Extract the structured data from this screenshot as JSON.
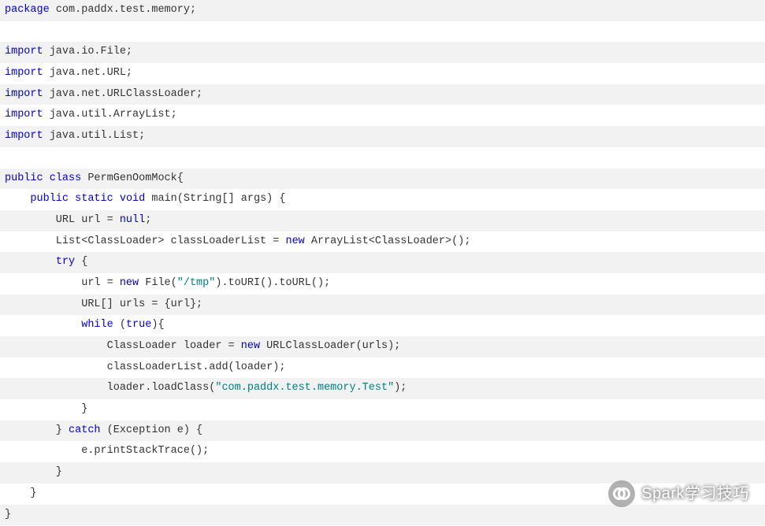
{
  "code": {
    "lines": [
      [
        {
          "c": "kw",
          "t": "package"
        },
        {
          "c": "txt",
          "t": " com.paddx.test.memory;"
        }
      ],
      [],
      [
        {
          "c": "kw",
          "t": "import"
        },
        {
          "c": "txt",
          "t": " java.io.File;"
        }
      ],
      [
        {
          "c": "kw",
          "t": "import"
        },
        {
          "c": "txt",
          "t": " java.net.URL;"
        }
      ],
      [
        {
          "c": "kw",
          "t": "import"
        },
        {
          "c": "txt",
          "t": " java.net.URLClassLoader;"
        }
      ],
      [
        {
          "c": "kw",
          "t": "import"
        },
        {
          "c": "txt",
          "t": " java.util.ArrayList;"
        }
      ],
      [
        {
          "c": "kw",
          "t": "import"
        },
        {
          "c": "txt",
          "t": " java.util.List;"
        }
      ],
      [],
      [
        {
          "c": "kw",
          "t": "public"
        },
        {
          "c": "txt",
          "t": " "
        },
        {
          "c": "kw",
          "t": "class"
        },
        {
          "c": "txt",
          "t": " PermGenOomMock{"
        }
      ],
      [
        {
          "c": "txt",
          "t": "    "
        },
        {
          "c": "kw",
          "t": "public"
        },
        {
          "c": "txt",
          "t": " "
        },
        {
          "c": "kw",
          "t": "static"
        },
        {
          "c": "txt",
          "t": " "
        },
        {
          "c": "kw",
          "t": "void"
        },
        {
          "c": "txt",
          "t": " main(String[] args) {"
        }
      ],
      [
        {
          "c": "txt",
          "t": "        URL url = "
        },
        {
          "c": "kw",
          "t": "null"
        },
        {
          "c": "txt",
          "t": ";"
        }
      ],
      [
        {
          "c": "txt",
          "t": "        List<ClassLoader> classLoaderList = "
        },
        {
          "c": "kw",
          "t": "new"
        },
        {
          "c": "txt",
          "t": " ArrayList<ClassLoader>();"
        }
      ],
      [
        {
          "c": "txt",
          "t": "        "
        },
        {
          "c": "kw",
          "t": "try"
        },
        {
          "c": "txt",
          "t": " {"
        }
      ],
      [
        {
          "c": "txt",
          "t": "            url = "
        },
        {
          "c": "kw",
          "t": "new"
        },
        {
          "c": "txt",
          "t": " File("
        },
        {
          "c": "str",
          "t": "\"/tmp\""
        },
        {
          "c": "txt",
          "t": ").toURI().toURL();"
        }
      ],
      [
        {
          "c": "txt",
          "t": "            URL[] urls = {url};"
        }
      ],
      [
        {
          "c": "txt",
          "t": "            "
        },
        {
          "c": "kw",
          "t": "while"
        },
        {
          "c": "txt",
          "t": " ("
        },
        {
          "c": "kw",
          "t": "true"
        },
        {
          "c": "txt",
          "t": "){"
        }
      ],
      [
        {
          "c": "txt",
          "t": "                ClassLoader loader = "
        },
        {
          "c": "kw",
          "t": "new"
        },
        {
          "c": "txt",
          "t": " URLClassLoader(urls);"
        }
      ],
      [
        {
          "c": "txt",
          "t": "                classLoaderList.add(loader);"
        }
      ],
      [
        {
          "c": "txt",
          "t": "                loader.loadClass("
        },
        {
          "c": "str",
          "t": "\"com.paddx.test.memory.Test\""
        },
        {
          "c": "txt",
          "t": ");"
        }
      ],
      [
        {
          "c": "txt",
          "t": "            }"
        }
      ],
      [
        {
          "c": "txt",
          "t": "        } "
        },
        {
          "c": "kw",
          "t": "catch"
        },
        {
          "c": "txt",
          "t": " (Exception e) {"
        }
      ],
      [
        {
          "c": "txt",
          "t": "            e.printStackTrace();"
        }
      ],
      [
        {
          "c": "txt",
          "t": "        }"
        }
      ],
      [
        {
          "c": "txt",
          "t": "    }"
        }
      ],
      [
        {
          "c": "txt",
          "t": "}"
        }
      ]
    ]
  },
  "watermark": {
    "text": "Spark学习技巧"
  }
}
